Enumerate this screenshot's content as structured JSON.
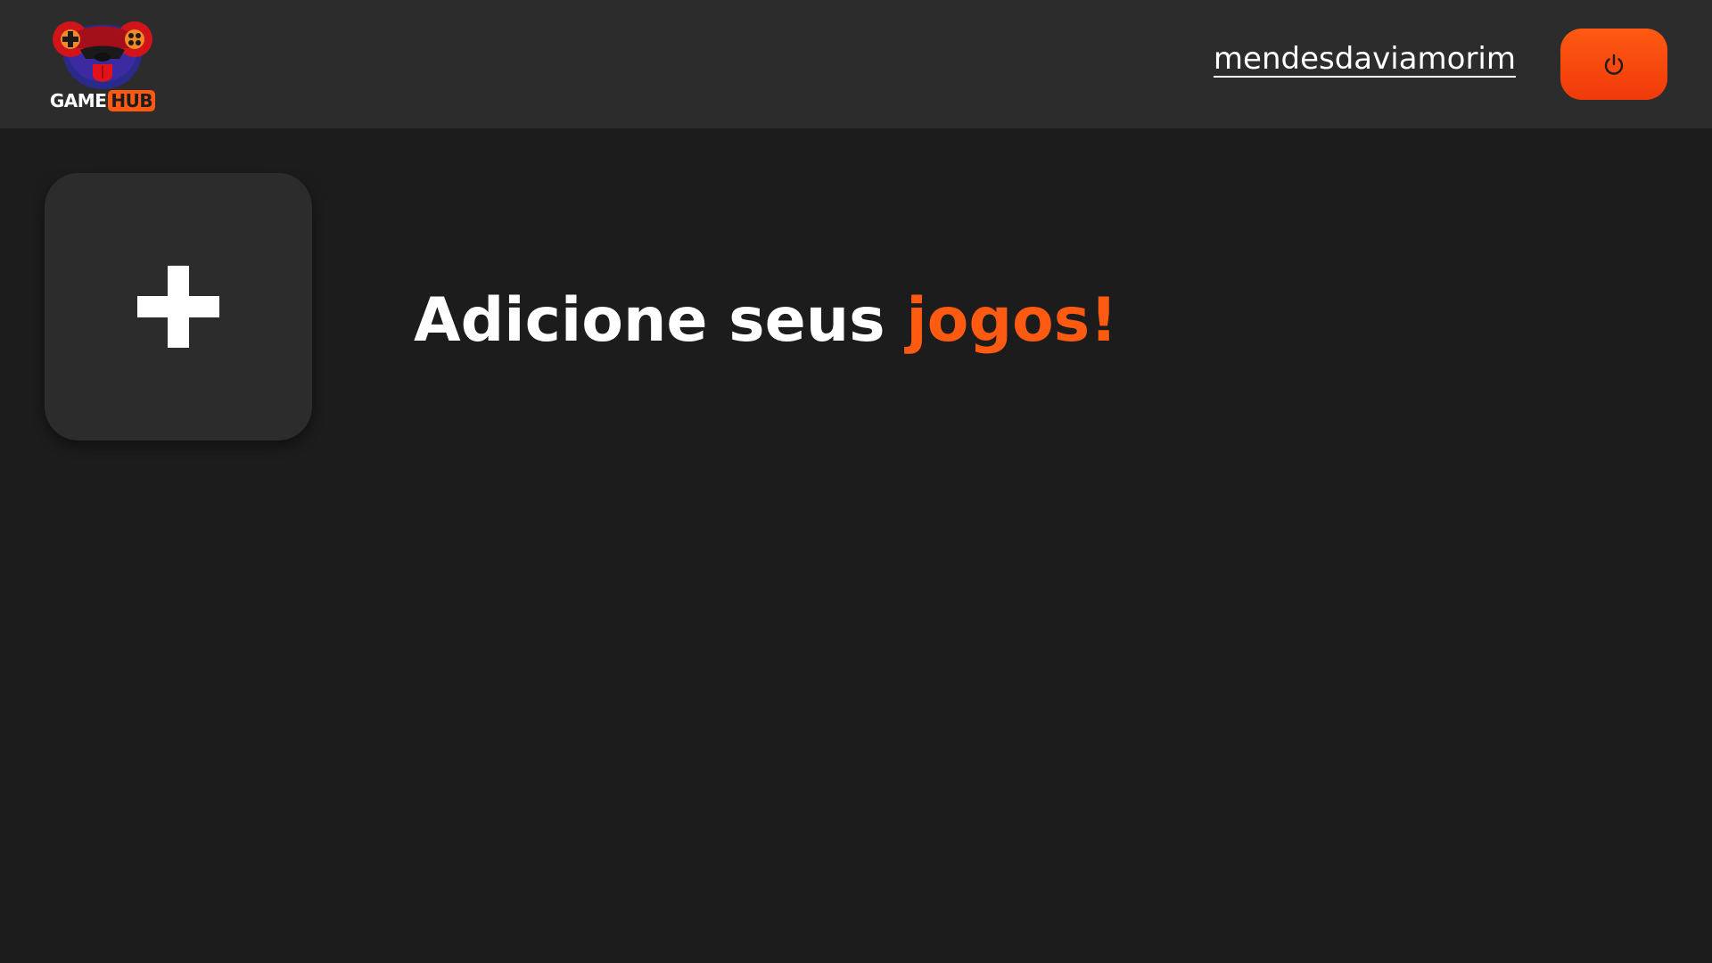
{
  "header": {
    "logo": {
      "text_primary": "GAME",
      "text_accent": "HUB",
      "icon": "gamepad-dog-mascot"
    },
    "username": "mendesdaviamorim",
    "logout_button": {
      "icon": "power-icon"
    }
  },
  "main": {
    "add_card": {
      "icon": "plus-icon"
    },
    "headline": {
      "prefix": "Adicione seus ",
      "accent": "jogos!"
    }
  },
  "colors": {
    "background": "#1c1c1c",
    "surface": "#2c2c2c",
    "accent": "#ff5a12",
    "text": "#ffffff"
  }
}
